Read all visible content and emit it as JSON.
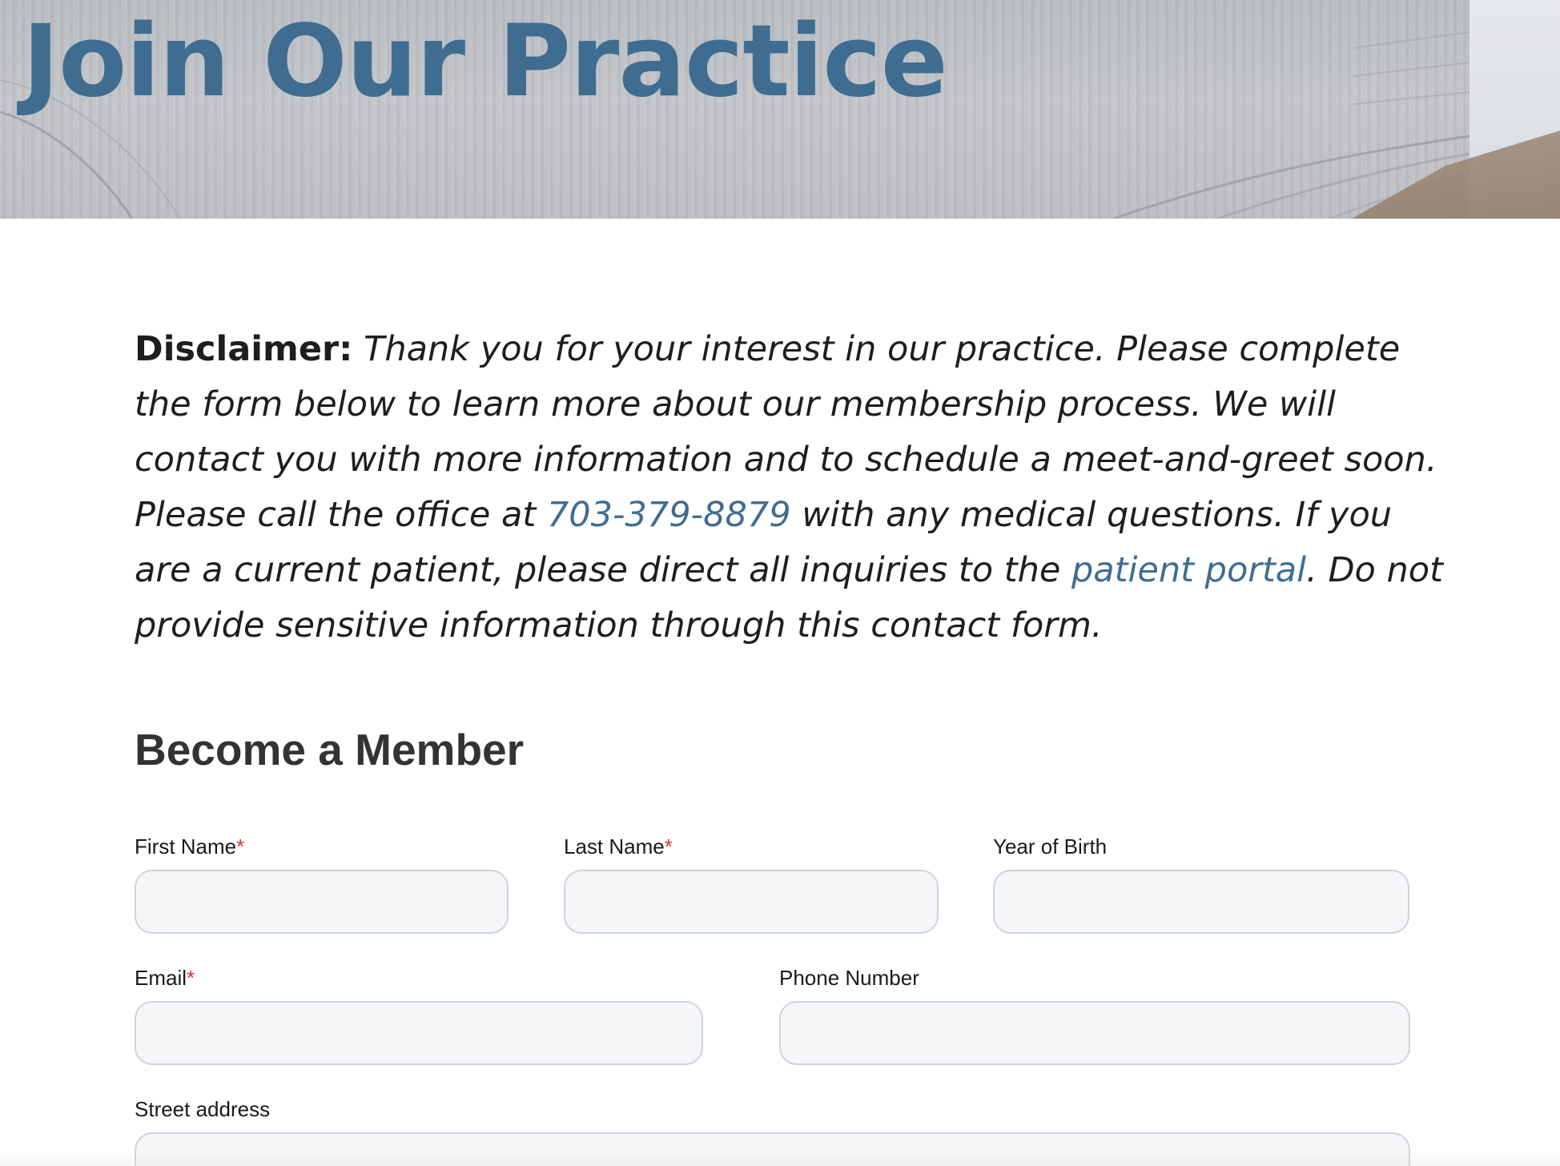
{
  "hero": {
    "title": "Join Our Practice"
  },
  "disclaimer": {
    "lead": "Disclaimer:",
    "text_before_phone": "Thank you for your interest in our practice. Please complete the form below to learn more about our membership process. We will contact you with more information and to schedule a meet-and-greet soon. Please call the office at ",
    "phone_link": "703-379-8879",
    "text_after_phone": " with any medical questions. If you are a current patient, please direct all inquiries to the ",
    "portal_link": "patient portal",
    "text_end": ". Do not provide sensitive information through this contact form."
  },
  "form": {
    "title": "Become a Member",
    "required_marker": "*",
    "fields": {
      "first_name": {
        "label": "First Name",
        "required": true,
        "value": ""
      },
      "last_name": {
        "label": "Last Name",
        "required": true,
        "value": ""
      },
      "year_of_birth": {
        "label": "Year of Birth",
        "required": false,
        "value": ""
      },
      "email": {
        "label": "Email",
        "required": true,
        "value": ""
      },
      "phone_number": {
        "label": "Phone Number",
        "required": false,
        "value": ""
      },
      "street_address": {
        "label": "Street address",
        "required": false,
        "value": ""
      }
    }
  },
  "colors": {
    "accent": "#3f6d92",
    "required": "#d63232",
    "heading": "#333333",
    "input_bg": "#f5f6f8",
    "input_border": "#cdd4df"
  }
}
